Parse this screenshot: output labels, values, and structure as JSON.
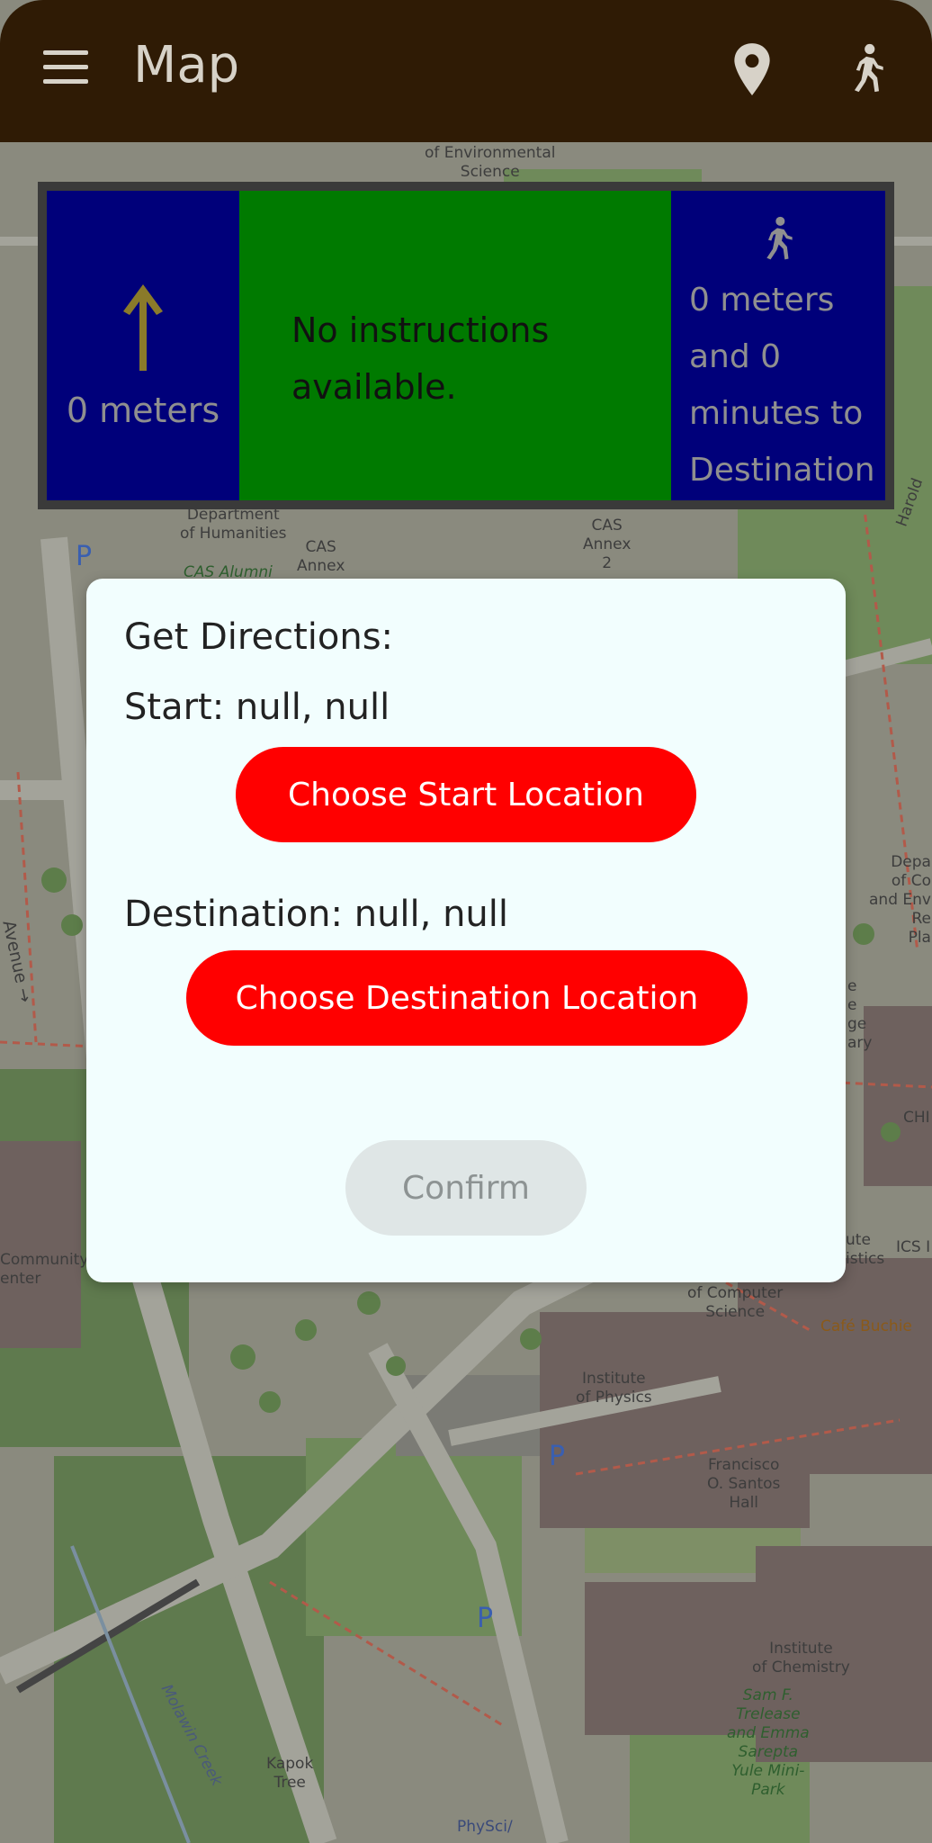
{
  "app_bar": {
    "title": "Map",
    "menu_icon": "hamburger-menu-icon",
    "location_icon": "location-pin-icon",
    "walk_icon": "walking-person-icon"
  },
  "navigation_panel": {
    "distance": "0 meters",
    "instruction": "No instructions available.",
    "eta": "0 meters and 0 minutes to Destination",
    "direction_icon": "arrow-up-icon",
    "colors": {
      "side": "#00007a",
      "middle": "#007a00",
      "arrow": "#8a7a2a"
    }
  },
  "dialog": {
    "heading": "Get Directions:",
    "start_text": "Start: null, null",
    "start_button": "Choose Start Location",
    "destination_text": "Destination: null, null",
    "destination_button": "Choose Destination Location",
    "confirm_button": "Confirm",
    "colors": {
      "primary_button": "#ff0000",
      "disabled_button": "#dfe6e6"
    }
  },
  "map_labels": {
    "env_science": "of Environmental\nScience",
    "humanities": "Department\nof Humanities",
    "cas_alumni": "CAS Alumni",
    "cas_annex": "CAS\nAnnex",
    "cas_annex2": "CAS\nAnnex\n2",
    "harold": "Harold",
    "dept_right": "Depa\nof Co\nand Env\nRe\nPla",
    "avenue": "Avenue →",
    "library": "e\ne\nge\nary",
    "chi": "CHI",
    "community": "Community\nenter",
    "ute_stics": "ute\nistics",
    "ics": "ICS I",
    "computer_science": "Institute\nof Computer\nScience",
    "cafe": "Café Buchie",
    "physics": "Institute\nof Physics",
    "santos": "Francisco\nO. Santos\nHall",
    "chemistry": "Institute\nof Chemistry",
    "trelease": "Sam F.\nTrelease\nand Emma\nSarepta\nYule Mini-\nPark",
    "kapok": "Kapok\nTree",
    "molawin": "Molawin Creek",
    "physci": "PhySci/"
  }
}
